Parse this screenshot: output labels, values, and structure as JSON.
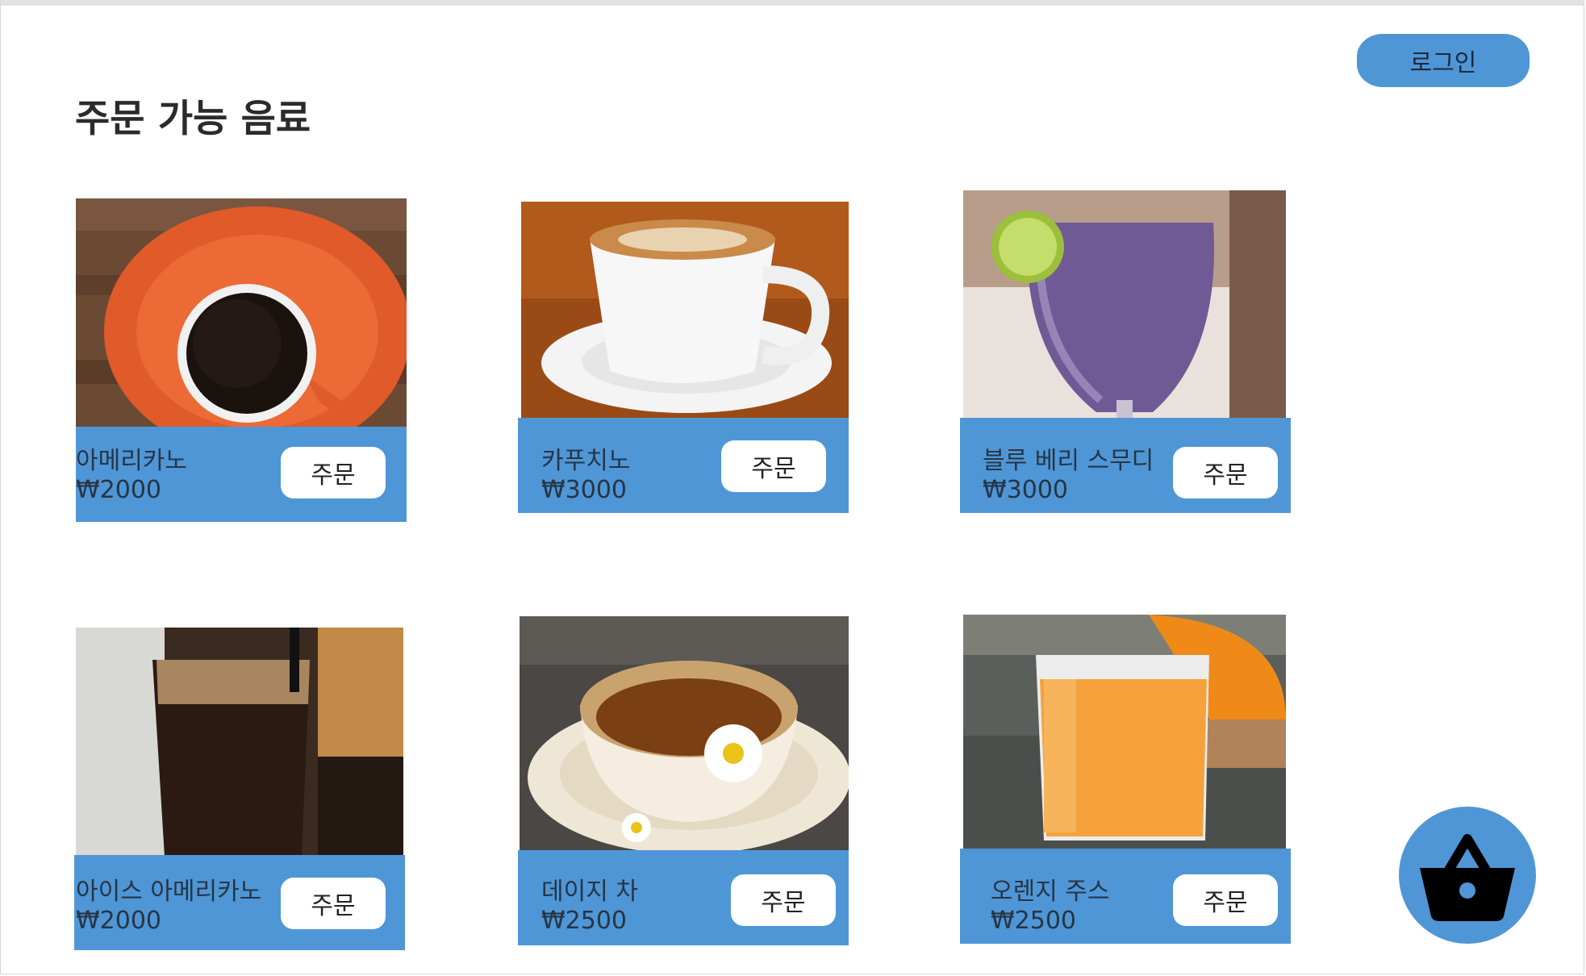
{
  "header": {
    "login_label": "로그인",
    "page_title": "주문 가능 음료"
  },
  "order_label": "주문",
  "drinks": [
    {
      "name": "아메리카노",
      "price": "₩2000",
      "image_icon": "americano-image"
    },
    {
      "name": "카푸치노",
      "price": "₩3000",
      "image_icon": "cappuccino-image"
    },
    {
      "name": "블루 베리 스무디",
      "price": "₩3000",
      "image_icon": "blueberry-smoothie-image"
    },
    {
      "name": "아이스 아메리카노",
      "price": "₩2000",
      "image_icon": "iced-americano-image"
    },
    {
      "name": "데이지 차",
      "price": "₩2500",
      "image_icon": "daisy-tea-image"
    },
    {
      "name": "오렌지 주스",
      "price": "₩2500",
      "image_icon": "orange-juice-image"
    }
  ],
  "cart": {
    "icon": "basket-icon"
  },
  "colors": {
    "accent": "#4f96d6",
    "button_bg": "#ffffff",
    "text": "#263545"
  }
}
